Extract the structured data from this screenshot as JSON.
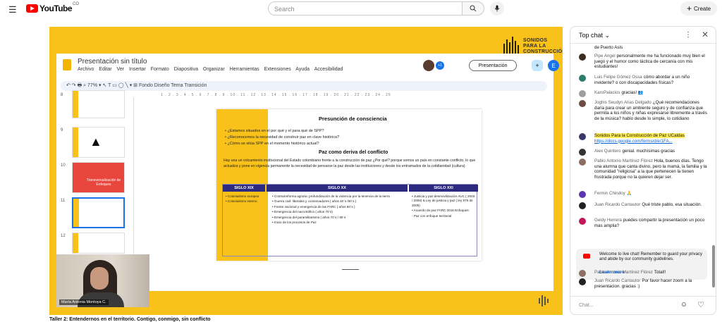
{
  "header": {
    "logo": "YouTube",
    "logo_suffix": "CO",
    "search_placeholder": "Search",
    "create_label": "Create"
  },
  "slides": {
    "doc_title": "Presentación sin título",
    "menu": [
      "Archivo",
      "Editar",
      "Ver",
      "Insertar",
      "Formato",
      "Diapositiva",
      "Organizar",
      "Herramientas",
      "Extensiones",
      "Ayuda",
      "Accesibilidad"
    ],
    "toolbar_text": "↶ ↷ 🖶 ⌕ 77% ▾  ↖ T ▭ ◯ ╲ ▾ ⊞   Fondo   Diseño   Tema   Transición",
    "zoom": "77%",
    "present_label": "Presentación",
    "user_initial": "E",
    "collab_count": "+1",
    "ruler": "1 . 2 . 3 . 4 . 5 . 6 . 7 . 8 . 9 . 10 . 11 . 12 . 13 . 14 . 15 . 16 . 17 . 18 . 19 . 20 . 21 . 22 . 23 . 24 . 25",
    "thumb_numbers": [
      "8",
      "9",
      "10",
      "11",
      "12"
    ],
    "thumb10_text": "Transversalización de Enfoques",
    "slide": {
      "title": "Presunción de consciencia",
      "bullets": [
        "¿Estamos situados en el por qué y el para qué de SPP?",
        "¿Reconocemos la necesidad de construir paz en clave histórica?",
        "¿Cómo se sitúa SPP en el momento histórico actual?"
      ],
      "subtitle": "Paz como deriva del conflicto",
      "paragraph": "Hay una un volcamiento institucional del Estado colombiano frente a la construcción de paz ¿Por qué? porque somos un país en constante conflicto, lo que actualiza y pone en vigencia permanente la necesidad de pensarse la paz desde las instituciones y desde los entramados de la cotidianidad (cultura)",
      "table": {
        "headers": [
          "SIGLO XIX",
          "SIGLO XX",
          "SIGLO XXI"
        ],
        "col1": [
          "Colonialismo europeo",
          "Colonialismo interno"
        ],
        "col2": [
          "Contrarreforma agraria: profundización de la violencia por la tenencia de la tierra",
          "Guerra civil: liberales y conservadores ( años 40´s /50´s )",
          "Frente nacional y emergencia de las FARC ( años 60´s )",
          "Emergencia del narcotráfico ( años 70´s)",
          "Emergencia del paramilitarismo ( años 70´s / 80´s",
          "Inicio de los procesos de Paz"
        ],
        "col3": [
          "Justicia y paz:desmovilización AUC ( 2003 / 2006) & Ley de justicia y paz ( ley 975 de 2005)",
          "Acuerdo de paz FARC 2016 Enfoques:",
          "Paz con enfoque territorial"
        ]
      }
    }
  },
  "brand": {
    "lines": [
      "SONIDOS",
      "PARA LA",
      "CONSTRUCCIÓN",
      "DE PAZ"
    ]
  },
  "presenter": {
    "name": "María Antonia Montoya C."
  },
  "caption": "Taller 2: Entendernos en el territorio. Contigo, conmigo, sin conflicto",
  "chat": {
    "title": "Top chat",
    "input_placeholder": "Chat...",
    "messages": [
      {
        "author": "",
        "text": "de Puerto Asís",
        "color": "#8a6d3b"
      },
      {
        "author": "Pipe Angel",
        "text": "personalmente me ha funcionado muy bien el juego y el humor como táctica de cercanía con mis estudiantes!",
        "color": "#3b2e1e"
      },
      {
        "author": "Luis Felipe Gómez Ossa",
        "text": "cómo abordar a un niño invidente? o con discapacidades físicas?",
        "color": "#2e7d6b"
      },
      {
        "author": "KaroPalacios",
        "text": "gracias! 👥",
        "color": "#9e9e9e"
      },
      {
        "author": "Joghis Seudyn Arias Delgado",
        "text": "¿Qué recomendaciones daría para crear un ambiente seguro y de confianza que permita a los niños y niñas expresarse libremente a través de la música? hablo desde lo simple, lo cotidiano",
        "color": "#6d4c41"
      },
      {
        "author": "Sonidos Para la Construcción de Paz UCaldas",
        "text": "https://docs.google.com/forms/d/e/1FA...",
        "color": "#3a3a6a"
      },
      {
        "author": "Alex Quintero",
        "text": "genial. muchísimas gracias",
        "color": "#333333"
      },
      {
        "author": "Pablo Antonio Martínez Flórez",
        "text": "Hola, buenos días. Tengo una alumna que canta divino, pero la mamá, la familia y la comunidad \"religiosa\" a la que pertenecen la tienen frustrada porque no la quieren dejar ser.",
        "color": "#8d6e63"
      },
      {
        "author": "Fermin Chindoy",
        "text": "🙏",
        "color": "#5e35b1"
      },
      {
        "author": "Juan Ricardo Cantautor",
        "text": "Qué triste pablo, esa situación.",
        "color": "#222222"
      },
      {
        "author": "Geidy Herrera",
        "text": "puedes compartir la presentación un poco mas amplia?",
        "color": "#c2185b"
      },
      {
        "author": "Pablo Antonio Martínez Flórez",
        "text": "Total!!",
        "color": "#8d6e63"
      },
      {
        "author": "Juan Ricardo Cantautor",
        "text": "Por favor hacer zoom a la presentacion. gracias :)",
        "color": "#222222"
      }
    ],
    "notice": {
      "text": "Welcome to live chat! Remember to guard your privacy and abide by our community guidelines.",
      "learn_more": "Learn more"
    }
  }
}
